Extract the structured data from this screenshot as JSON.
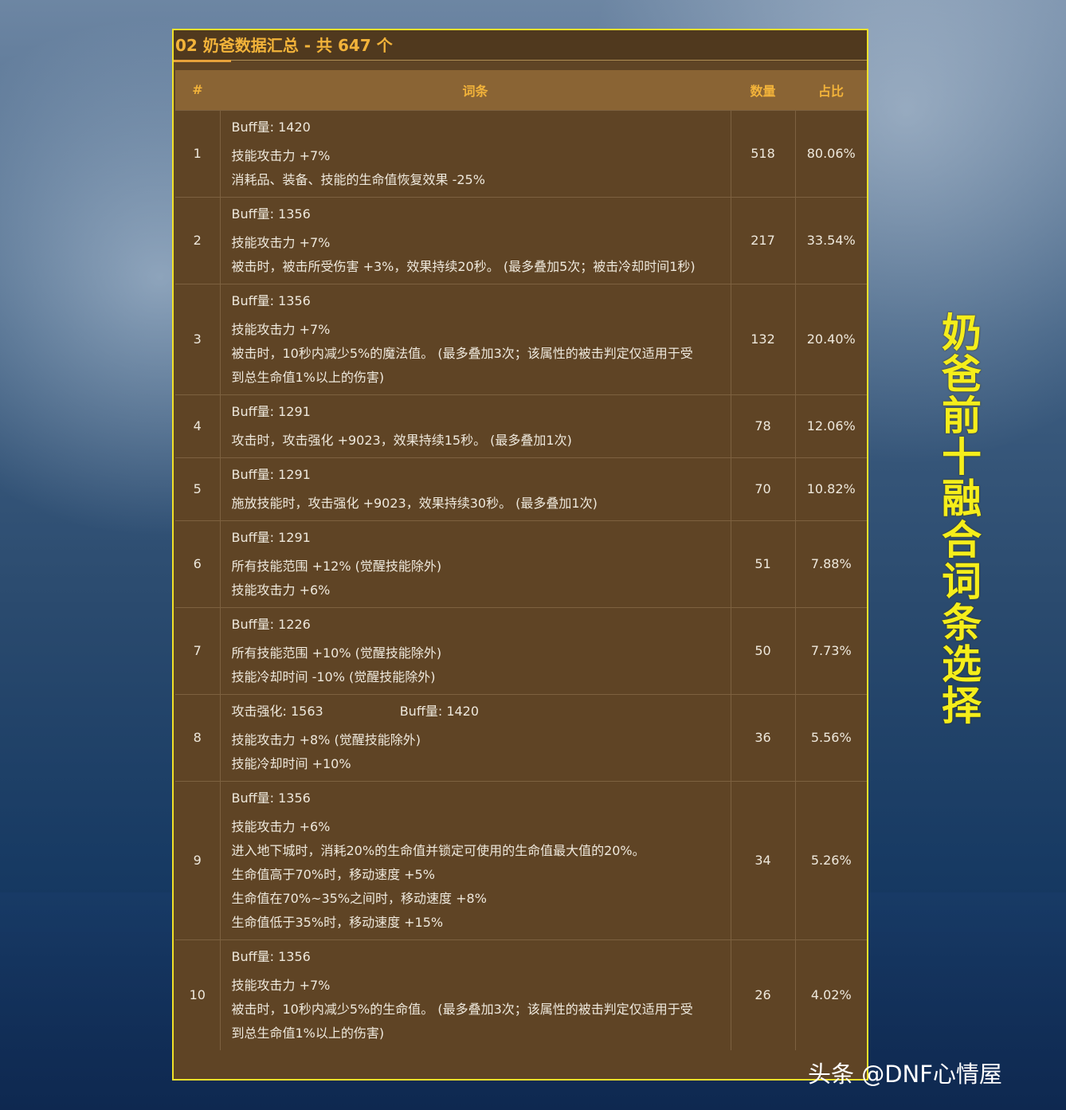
{
  "panel": {
    "title": "02 奶爸数据汇总 - 共 647 个",
    "headers": {
      "index": "#",
      "entry": "词条",
      "count": "数量",
      "ratio": "占比"
    }
  },
  "rows": [
    {
      "idx": "1",
      "lines": [
        "Buff量: 1420",
        "技能攻击力 +7%",
        "消耗品、装备、技能的生命值恢复效果 -25%"
      ],
      "count": "518",
      "ratio": "80.06%"
    },
    {
      "idx": "2",
      "lines": [
        "Buff量: 1356",
        "技能攻击力 +7%",
        "被击时，被击所受伤害 +3%，效果持续20秒。 (最多叠加5次；被击冷却时间1秒)"
      ],
      "count": "217",
      "ratio": "33.54%"
    },
    {
      "idx": "3",
      "lines": [
        "Buff量: 1356",
        "技能攻击力 +7%",
        "被击时，10秒内减少5%的魔法值。 (最多叠加3次；该属性的被击判定仅适用于受",
        "到总生命值1%以上的伤害)"
      ],
      "count": "132",
      "ratio": "20.40%"
    },
    {
      "idx": "4",
      "lines": [
        "Buff量: 1291",
        "攻击时，攻击强化 +9023，效果持续15秒。 (最多叠加1次)"
      ],
      "count": "78",
      "ratio": "12.06%"
    },
    {
      "idx": "5",
      "lines": [
        "Buff量: 1291",
        "施放技能时，攻击强化 +9023，效果持续30秒。 (最多叠加1次)"
      ],
      "count": "70",
      "ratio": "10.82%"
    },
    {
      "idx": "6",
      "lines": [
        "Buff量: 1291",
        "所有技能范围 +12% (觉醒技能除外)",
        "技能攻击力 +6%"
      ],
      "count": "51",
      "ratio": "7.88%"
    },
    {
      "idx": "7",
      "lines": [
        "Buff量: 1226",
        "所有技能范围 +10% (觉醒技能除外)",
        "技能冷却时间 -10% (觉醒技能除外)"
      ],
      "count": "50",
      "ratio": "7.73%"
    },
    {
      "idx": "8",
      "first_a": "攻击强化: 1563",
      "first_b": "Buff量: 1420",
      "lines": [
        "技能攻击力 +8% (觉醒技能除外)",
        "技能冷却时间 +10%"
      ],
      "count": "36",
      "ratio": "5.56%"
    },
    {
      "idx": "9",
      "lines": [
        "Buff量: 1356",
        "技能攻击力 +6%",
        "进入地下城时，消耗20%的生命值并锁定可使用的生命值最大值的20%。",
        "生命值高于70%时，移动速度 +5%",
        "生命值在70%~35%之间时，移动速度 +8%",
        "生命值低于35%时，移动速度 +15%"
      ],
      "count": "34",
      "ratio": "5.26%"
    },
    {
      "idx": "10",
      "lines": [
        "Buff量: 1356",
        "技能攻击力 +7%",
        "被击时，10秒内减少5%的生命值。 (最多叠加3次；该属性的被击判定仅适用于受",
        "到总生命值1%以上的伤害)"
      ],
      "count": "26",
      "ratio": "4.02%"
    }
  ],
  "side_title": "奶爸前十融合词条选择",
  "watermark": "头条 @DNF心情屋",
  "colors": {
    "panel_border": "#f0e12a",
    "header_text": "#f2b33a",
    "side_title": "#f5ee1b"
  }
}
